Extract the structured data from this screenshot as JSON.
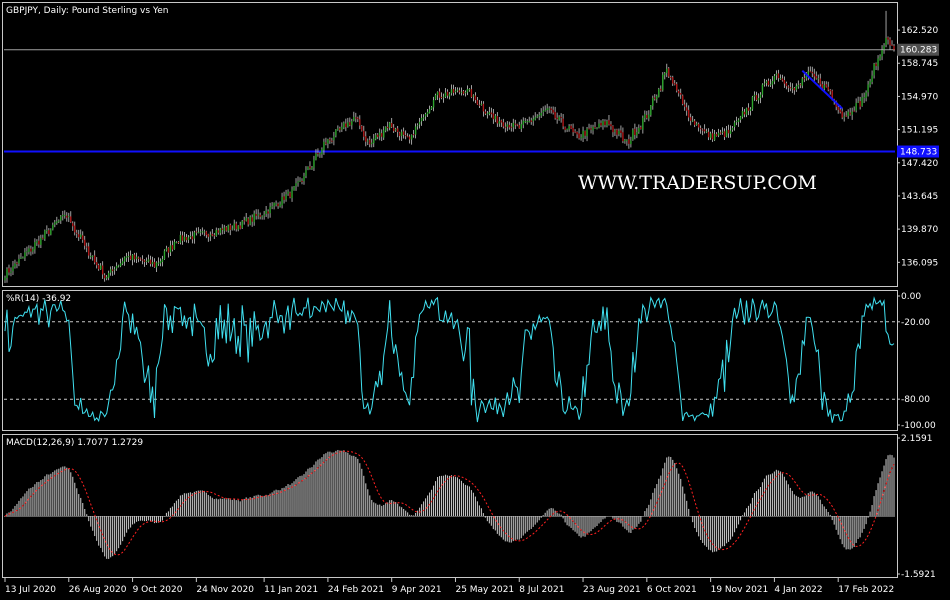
{
  "colors": {
    "background": "#000000",
    "frame": "#c8c8c8",
    "bull": "#2ea82e",
    "bear": "#b01818",
    "wick": "#c8c8c8",
    "support_line": "#1010ff",
    "trend_line": "#1010ff",
    "price_line": "#a0a0a0",
    "wpr_line": "#40e0f0",
    "macd_hist": "#c0c0c0",
    "macd_signal": "#ff2020",
    "label_bg": "#1010ff",
    "price_box_bg": "#505050"
  },
  "chart_data": [
    {
      "type": "candlestick",
      "title": "GBPJPY, Daily:  Pound Sterling vs Yen",
      "symbol": "GBPJPY",
      "timeframe": "Daily",
      "ylim": [
        133.4,
        165.6
      ],
      "y_ticks": [
        "162.520",
        "158.745",
        "154.970",
        "151.195",
        "147.420",
        "143.645",
        "139.870",
        "136.095"
      ],
      "current_price": "160.283",
      "horizontal_line": {
        "value": 148.7,
        "label": "148.733"
      },
      "watermark": "WWW.TRADERSUP.COM",
      "trend_line": {
        "from": {
          "date": "2022-01-24",
          "price": 157.9
        },
        "to": {
          "date": "2022-02-21",
          "price": 153.6
        }
      },
      "close_anchors": [
        {
          "date": "2020-07-13",
          "close": 134.8
        },
        {
          "date": "2020-08-03",
          "close": 138.2
        },
        {
          "date": "2020-08-24",
          "close": 141.6
        },
        {
          "date": "2020-09-08",
          "close": 137.5
        },
        {
          "date": "2020-09-21",
          "close": 134.4
        },
        {
          "date": "2020-10-05",
          "close": 136.8
        },
        {
          "date": "2020-10-26",
          "close": 135.8
        },
        {
          "date": "2020-11-10",
          "close": 138.7
        },
        {
          "date": "2020-12-01",
          "close": 139.4
        },
        {
          "date": "2020-12-22",
          "close": 140.2
        },
        {
          "date": "2021-01-11",
          "close": 141.8
        },
        {
          "date": "2021-02-01",
          "close": 144.4
        },
        {
          "date": "2021-02-22",
          "close": 149.6
        },
        {
          "date": "2021-03-15",
          "close": 152.6
        },
        {
          "date": "2021-03-25",
          "close": 149.5
        },
        {
          "date": "2021-04-08",
          "close": 151.8
        },
        {
          "date": "2021-04-22",
          "close": 149.9
        },
        {
          "date": "2021-05-10",
          "close": 155.0
        },
        {
          "date": "2021-06-01",
          "close": 155.7
        },
        {
          "date": "2021-06-21",
          "close": 152.4
        },
        {
          "date": "2021-07-08",
          "close": 151.4
        },
        {
          "date": "2021-07-28",
          "close": 153.4
        },
        {
          "date": "2021-08-18",
          "close": 150.4
        },
        {
          "date": "2021-09-08",
          "close": 152.0
        },
        {
          "date": "2021-09-22",
          "close": 149.7
        },
        {
          "date": "2021-10-06",
          "close": 152.8
        },
        {
          "date": "2021-10-20",
          "close": 157.9
        },
        {
          "date": "2021-11-05",
          "close": 152.6
        },
        {
          "date": "2021-11-19",
          "close": 150.4
        },
        {
          "date": "2021-12-03",
          "close": 150.8
        },
        {
          "date": "2021-12-24",
          "close": 155.4
        },
        {
          "date": "2022-01-05",
          "close": 157.5
        },
        {
          "date": "2022-01-18",
          "close": 155.7
        },
        {
          "date": "2022-01-28",
          "close": 157.6
        },
        {
          "date": "2022-02-10",
          "close": 155.8
        },
        {
          "date": "2022-02-21",
          "close": 152.7
        },
        {
          "date": "2022-03-07",
          "close": 154.6
        },
        {
          "date": "2022-03-18",
          "close": 159.6
        },
        {
          "date": "2022-03-23",
          "close": 161.4
        },
        {
          "date": "2022-03-29",
          "close": 160.28
        }
      ]
    },
    {
      "type": "line",
      "title": "%R(14) -36.92",
      "indicator": "Williams %R",
      "ylim": [
        -100,
        0
      ],
      "y_ticks": [
        "0.00",
        "-20.00",
        "-80.00",
        "-100.00"
      ],
      "levels": [
        -20,
        -80
      ],
      "last_value": -36.92
    },
    {
      "type": "bar",
      "title": "MACD(12,26,9) 1.7077 1.2729",
      "indicator": "MACD",
      "params": [
        12,
        26,
        9
      ],
      "macd_value": 1.7077,
      "signal_value": 1.2729,
      "ylim": [
        -1.5921,
        2.1591
      ],
      "y_ticks": [
        "2.1591",
        "-1.5921"
      ]
    }
  ],
  "x_axis": {
    "labels": [
      "13 Jul 2020",
      "26 Aug 2020",
      "9 Oct 2020",
      "24 Nov 2020",
      "11 Jan 2021",
      "24 Feb 2021",
      "9 Apr 2021",
      "25 May 2021",
      "8 Jul 2021",
      "23 Aug 2021",
      "6 Oct 2021",
      "19 Nov 2021",
      "4 Jan 2022",
      "17 Feb 2022"
    ]
  }
}
